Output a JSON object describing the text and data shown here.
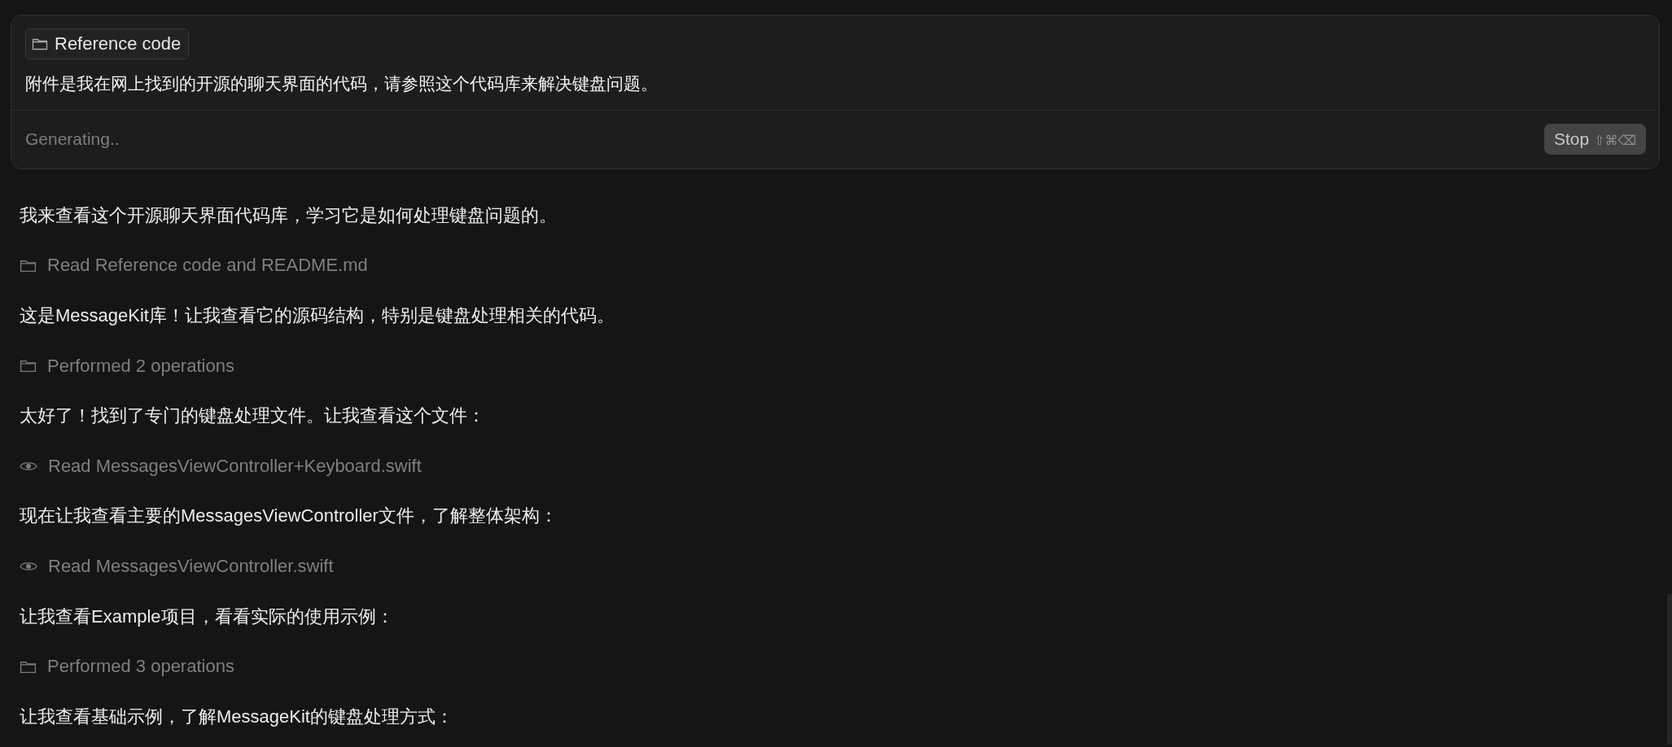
{
  "composer": {
    "attachment": {
      "label": "Reference code"
    },
    "message": "附件是我在网上找到的开源的聊天界面的代码，请参照这个代码库来解决键盘问题。",
    "status": "Generating..",
    "stop_button": {
      "label": "Stop",
      "shortcut": "⇧⌘⌫"
    }
  },
  "conversation": [
    {
      "kind": "text",
      "text": "我来查看这个开源聊天界面代码库，学习它是如何处理键盘问题的。"
    },
    {
      "kind": "browse",
      "text": "Read Reference code and README.md"
    },
    {
      "kind": "text",
      "text": "这是MessageKit库！让我查看它的源码结构，特别是键盘处理相关的代码。"
    },
    {
      "kind": "browse",
      "text": "Performed 2 operations"
    },
    {
      "kind": "text",
      "text": "太好了！找到了专门的键盘处理文件。让我查看这个文件："
    },
    {
      "kind": "read",
      "text": "Read MessagesViewController+Keyboard.swift"
    },
    {
      "kind": "text",
      "text": "现在让我查看主要的MessagesViewController文件，了解整体架构："
    },
    {
      "kind": "read",
      "text": "Read MessagesViewController.swift"
    },
    {
      "kind": "text",
      "text": "让我查看Example项目，看看实际的使用示例："
    },
    {
      "kind": "browse",
      "text": "Performed 3 operations"
    },
    {
      "kind": "text",
      "text": "让我查看基础示例，了解MessageKit的键盘处理方式："
    }
  ]
}
